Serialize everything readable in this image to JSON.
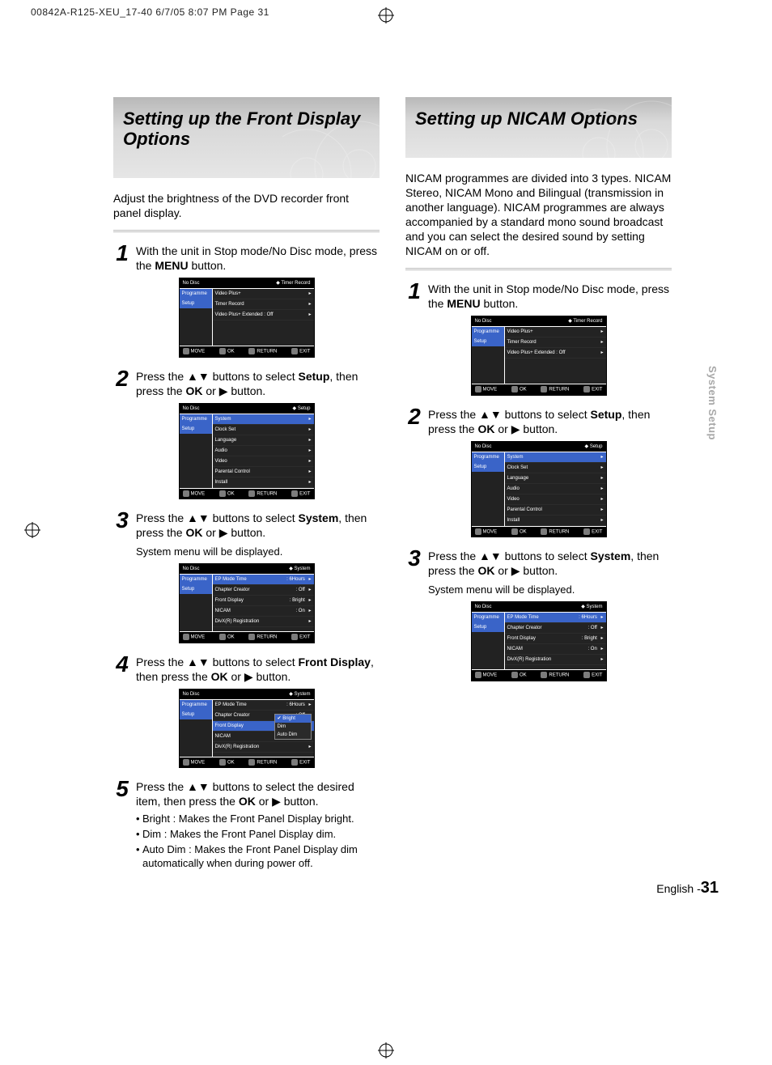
{
  "print_note": "00842A-R125-XEU_17-40  6/7/05  8:07 PM  Page 31",
  "sidetab": "System Setup",
  "page_label": "English -",
  "page_number": "31",
  "left": {
    "title": "Setting up the Front Display Options",
    "intro": "Adjust the brightness of the DVD recorder front panel display.",
    "steps": [
      {
        "num": "1",
        "text": "With the unit in Stop mode/No Disc mode, press the <b>MENU</b> button."
      },
      {
        "num": "2",
        "text": "Press the ▲▼ buttons to select <b>Setup</b>, then press the <b>OK</b> or ▶ button."
      },
      {
        "num": "3",
        "text": "Press the ▲▼ buttons to select <b>System</b>, then press the <b>OK</b> or ▶ button.",
        "sub": "System menu will be displayed."
      },
      {
        "num": "4",
        "text": "Press the ▲▼ buttons to select <b>Front Display</b>, then press the <b>OK</b> or ▶ button."
      },
      {
        "num": "5",
        "text": "Press the ▲▼ buttons to select the desired item, then press the <b>OK</b> or ▶ button.",
        "bullets": [
          "Bright : Makes the Front Panel Display bright.",
          "Dim : Makes the Front Panel Display dim.",
          "Auto Dim : Makes the Front Panel Display dim automatically when during power off."
        ]
      }
    ]
  },
  "right": {
    "title": "Setting up NICAM Options",
    "intro": "NICAM programmes are divided into 3 types. NICAM Stereo, NICAM Mono and Bilingual (transmission in another language). NICAM programmes are always accompanied by a standard mono sound broadcast and you can select the desired sound by setting NICAM  on or off.",
    "steps": [
      {
        "num": "1",
        "text": "With the unit in Stop mode/No Disc mode, press the <b>MENU</b> button."
      },
      {
        "num": "2",
        "text": "Press the ▲▼ buttons to select <b>Setup</b>, then press the <b>OK</b> or ▶ button."
      },
      {
        "num": "3",
        "text": "Press the ▲▼ buttons to select <b>System</b>, then press the <b>OK</b> or ▶ button.",
        "sub": "System menu will be displayed."
      }
    ]
  },
  "osd": {
    "nodisc": "No Disc",
    "timer_record": "Timer Record",
    "setup_label": "Setup",
    "system_label": "System",
    "side_programme": "Programme",
    "side_setup": "Setup",
    "footer": {
      "move": "MOVE",
      "ok": "OK",
      "ret": "RETURN",
      "exit": "EXIT"
    },
    "menu1_items": [
      "Video Plus+",
      "Timer Record",
      "Video Plus+ Extended : Off"
    ],
    "menu2_hdr": "System",
    "menu2_items": [
      "Clock Set",
      "Language",
      "Audio",
      "Video",
      "Parental Control",
      "Install"
    ],
    "menu3_rows": [
      [
        "EP Mode Time",
        ": 6Hours"
      ],
      [
        "Chapter Creator",
        ": Off"
      ],
      [
        "Front Display",
        ": Bright"
      ],
      [
        "NICAM",
        ": On"
      ],
      [
        "DivX(R) Registration",
        ""
      ]
    ],
    "menu4_popup": [
      "Bright",
      "Dim",
      "Auto Dim"
    ]
  }
}
